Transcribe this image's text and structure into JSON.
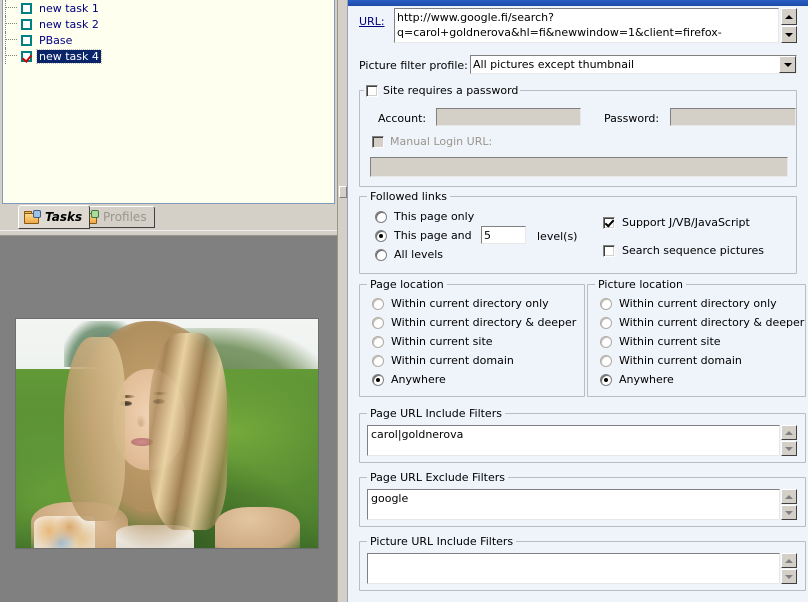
{
  "app": {
    "accent_blue": "#1b4aa8",
    "panel_bg": "#eff3fa",
    "tree_bg": "#fffff0"
  },
  "task_tree": {
    "items": [
      {
        "label": "new task 1",
        "checked": false,
        "selected": false
      },
      {
        "label": "new task 2",
        "checked": false,
        "selected": false
      },
      {
        "label": "PBase",
        "checked": false,
        "selected": false
      },
      {
        "label": "new task 4",
        "checked": true,
        "selected": true
      }
    ]
  },
  "tabs": [
    {
      "label": "Tasks",
      "active": true,
      "icon": "folder-blue-icon"
    },
    {
      "label": "Profiles",
      "active": false,
      "icon": "folder-green-icon"
    }
  ],
  "url_row": {
    "label": "URL:",
    "value_line1": "http://www.google.fi/search?",
    "value_line2": "q=carol+goldnerova&hl=fi&newwindow=1&client=firefox-"
  },
  "picture_filter": {
    "label": "Picture filter profile:",
    "selected": "All pictures except thumbnail"
  },
  "password_group": {
    "title": "Site requires a password",
    "checked": false,
    "account_label": "Account:",
    "account_value": "",
    "password_label": "Password:",
    "password_value": "",
    "manual_login_label": "Manual Login URL:",
    "manual_login_checked": false,
    "manual_login_value": ""
  },
  "followed_links": {
    "title": "Followed links",
    "options": [
      {
        "label": "This page only",
        "selected": false
      },
      {
        "label": "This page and",
        "selected": true
      },
      {
        "label": "All levels",
        "selected": false
      }
    ],
    "levels_value": "5",
    "levels_suffix": "level(s)",
    "checkboxes": [
      {
        "label": "Support J/VB/JavaScript",
        "checked": true
      },
      {
        "label": "Search sequence pictures",
        "checked": false
      }
    ]
  },
  "page_location": {
    "title": "Page location",
    "options": [
      {
        "label": "Within current directory only",
        "selected": false
      },
      {
        "label": "Within current directory & deeper",
        "selected": false
      },
      {
        "label": "Within current site",
        "selected": false
      },
      {
        "label": "Within current domain",
        "selected": false
      },
      {
        "label": "Anywhere",
        "selected": true
      }
    ]
  },
  "picture_location": {
    "title": "Picture location",
    "options": [
      {
        "label": "Within current directory only",
        "selected": false
      },
      {
        "label": "Within current directory & deeper",
        "selected": false
      },
      {
        "label": "Within current site",
        "selected": false
      },
      {
        "label": "Within current domain",
        "selected": false
      },
      {
        "label": "Anywhere",
        "selected": true
      }
    ]
  },
  "page_url_include": {
    "title": "Page URL Include Filters",
    "value": "carol|goldnerova"
  },
  "page_url_exclude": {
    "title": "Page URL Exclude Filters",
    "value": "google"
  },
  "picture_url_include": {
    "title": "Picture URL Include Filters",
    "value": ""
  },
  "preview": {
    "alt": "portrait photo of a blonde woman outdoors with green trees and hill behind"
  }
}
